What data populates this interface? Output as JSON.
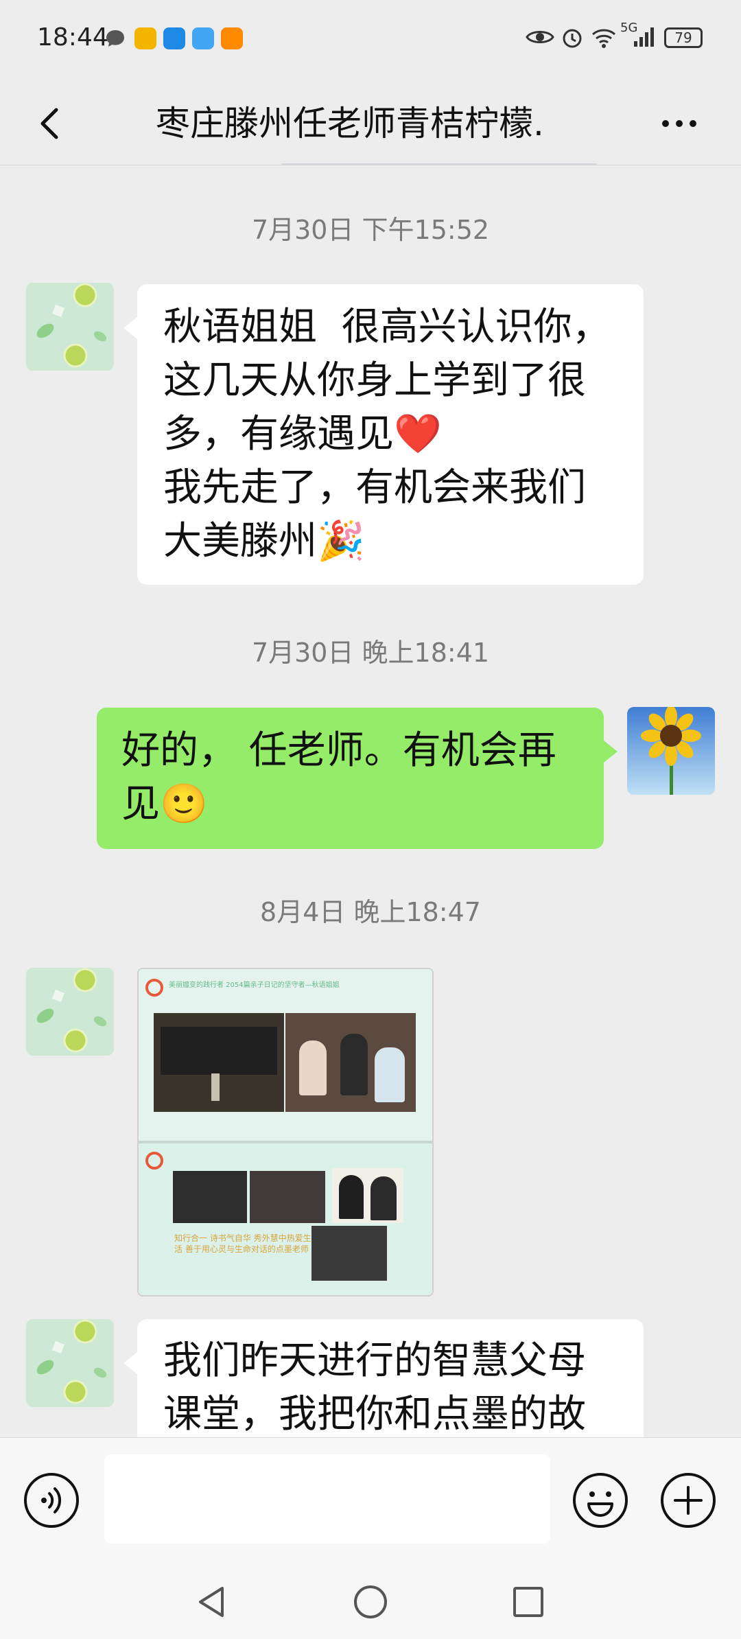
{
  "status_bar": {
    "time": "18:44",
    "network": "5G",
    "battery": "79",
    "icons_left": [
      "message-icon",
      "notebook-app-icon",
      "browser-app-icon",
      "cloud-app-icon",
      "video-app-icon"
    ],
    "icons_right": [
      "eye-icon",
      "alarm-icon",
      "wifi-icon",
      "signal-icon",
      "battery-icon"
    ]
  },
  "header": {
    "title": "枣庄滕州任老师青桔柠檬.",
    "back_icon": "chevron-left-icon",
    "more_icon": "more-icon"
  },
  "messages": [
    {
      "type": "timestamp",
      "text": "7月30日 下午15:52"
    },
    {
      "type": "text",
      "direction": "in",
      "avatar": "lime-avatar",
      "text": "秋语姐姐  很高兴认识你，这几天从你身上学到了很多，有缘遇见❤️\n我先走了，有机会来我们大美滕州🎉"
    },
    {
      "type": "timestamp",
      "text": "7月30日 晚上18:41"
    },
    {
      "type": "text",
      "direction": "out",
      "avatar": "sunflower-avatar",
      "text": "好的， 任老师。有机会再见🙂"
    },
    {
      "type": "timestamp",
      "text": "8月4日 晚上18:47"
    },
    {
      "type": "image",
      "direction": "in",
      "avatar": "lime-avatar",
      "image": {
        "panel1_title": "美丽嬗变的践行者 2054篇亲子日记的坚守者—秋语姐姐",
        "panel2_caption": "知行合一 诗书气自华 秀外慧中热爱生活 善于用心灵与生命对话的点墨老师"
      }
    },
    {
      "type": "text",
      "direction": "in",
      "avatar": "lime-avatar",
      "text": "我们昨天进行的智慧父母课堂，我把你和点墨的故"
    }
  ],
  "input_bar": {
    "voice_icon": "voice-icon",
    "input_value": "",
    "emoji_icon": "emoji-icon",
    "plus_icon": "plus-icon"
  },
  "nav_bar": {
    "icons": [
      "back-triangle-icon",
      "home-circle-icon",
      "recents-square-icon"
    ]
  },
  "colors": {
    "background": "#ededed",
    "outgoing_bubble": "#95ec69",
    "incoming_bubble": "#ffffff",
    "timestamp_text": "#7a7a7a"
  }
}
